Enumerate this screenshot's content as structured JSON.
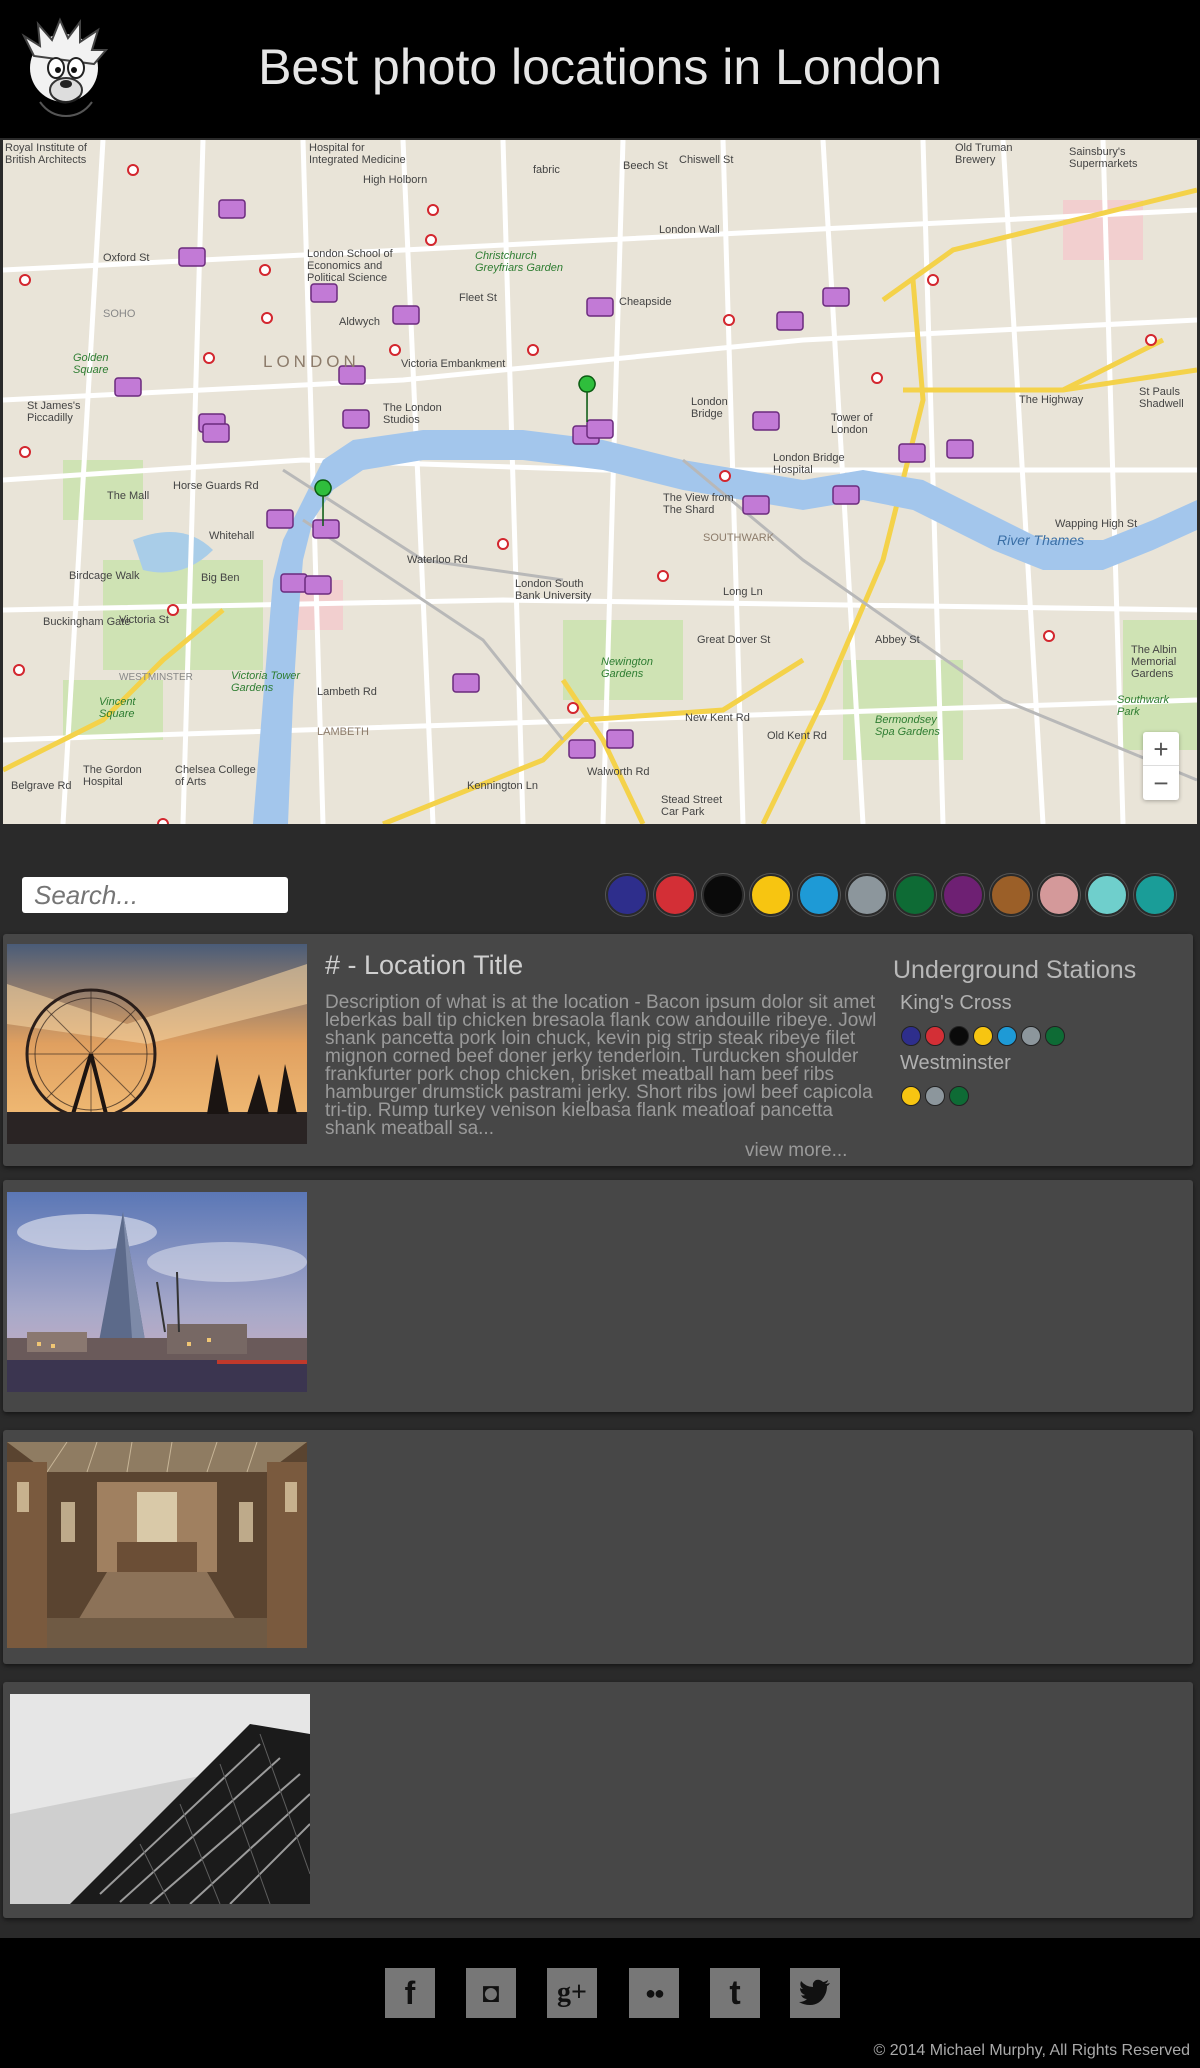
{
  "header": {
    "title": "Best photo locations in London",
    "logo_icon": "cartoon-dog-logo"
  },
  "map": {
    "labels": [
      "Royal Institute of British Architects",
      "Hospital for Integrated Medicine",
      "Old Truman Brewery",
      "Sainsbury's Supermarkets",
      "High Holborn",
      "fabric",
      "Beech St",
      "Chiswell St",
      "Oxford St",
      "London School of Economics and Political Science",
      "Christchurch Greyfriars Garden",
      "London Wall",
      "Cheapside",
      "Fleet St",
      "SOHO",
      "Aldwych",
      "Golden Square",
      "LONDON",
      "Victoria Embankment",
      "St James's Piccadilly",
      "The London Studios",
      "London Bridge",
      "Tower of London",
      "The Highway",
      "St Pauls Shadwell",
      "The Mall",
      "Horse Guards Rd",
      "Whitehall",
      "London Bridge Hospital",
      "The View from The Shard",
      "SOUTHWARK",
      "River Thames",
      "Wapping High St",
      "Birdcage Walk",
      "Big Ben",
      "Waterloo Rd",
      "London South Bank University",
      "Long Ln",
      "Abbey St",
      "The Albin Memorial Gardens",
      "Buckingham Gate",
      "Victoria St",
      "WESTMINSTER",
      "Victoria Tower Gardens",
      "Lambeth Rd",
      "Newington Gardens",
      "Great Dover St",
      "Southwark Park",
      "Vincent Square",
      "LAMBETH",
      "New Kent Rd",
      "Old Kent Rd",
      "Bermondsey Spa Gardens",
      "The Gordon Hospital",
      "Chelsea College of Arts",
      "Kennington Ln",
      "Walworth Rd",
      "Stead Street Car Park",
      "Belgrave Rd"
    ],
    "zoom_in": "+",
    "zoom_out": "−"
  },
  "filters": {
    "search_placeholder": "Search...",
    "line_colors": [
      "#2e2e8c",
      "#d32f36",
      "#0a0a0a",
      "#f7c511",
      "#1e9ad6",
      "#8c969c",
      "#0e6b35",
      "#6e2073",
      "#9b5f28",
      "#d4999a",
      "#6fcfcc",
      "#1a9d98"
    ]
  },
  "locations": [
    {
      "title": "# - Location Title",
      "description": "Description of what is at the location - Bacon ipsum dolor sit amet leberkas ball tip chicken bresaola flank cow andouille ribeye. Jowl shank pancetta pork loin chuck, kevin pig strip steak ribeye filet mignon corned beef doner jerky tenderloin. Turducken shoulder frankfurter pork chop chicken, brisket meatball ham beef ribs hamburger drumstick pastrami jerky. Short ribs jowl beef capicola tri-tip. Rump turkey venison kielbasa flank meatloaf pancetta shank meatball sa...",
      "view_more": "view more...",
      "underground_title": "Underground Stations",
      "stations": [
        {
          "name": "King's Cross",
          "lines": [
            "#2e2e8c",
            "#d32f36",
            "#0a0a0a",
            "#f7c511",
            "#1e9ad6",
            "#8c969c",
            "#0e6b35"
          ]
        },
        {
          "name": "Westminster",
          "lines": [
            "#f7c511",
            "#8c969c",
            "#0e6b35"
          ]
        }
      ],
      "photo": "london-eye-sunset"
    },
    {
      "photo": "the-shard-skyline"
    },
    {
      "photo": "natural-history-museum-hall"
    },
    {
      "photo": "black-white-tower-block"
    }
  ],
  "footer": {
    "social": [
      {
        "icon": "facebook-icon",
        "glyph": "f"
      },
      {
        "icon": "instagram-icon",
        "glyph": "◘"
      },
      {
        "icon": "google-plus-icon",
        "glyph": "g+"
      },
      {
        "icon": "flickr-icon",
        "glyph": "●●"
      },
      {
        "icon": "tumblr-icon",
        "glyph": "t"
      },
      {
        "icon": "twitter-icon",
        "glyph": "🐦"
      }
    ],
    "copyright": "© 2014 Michael Murphy, All Rights Reserved"
  }
}
